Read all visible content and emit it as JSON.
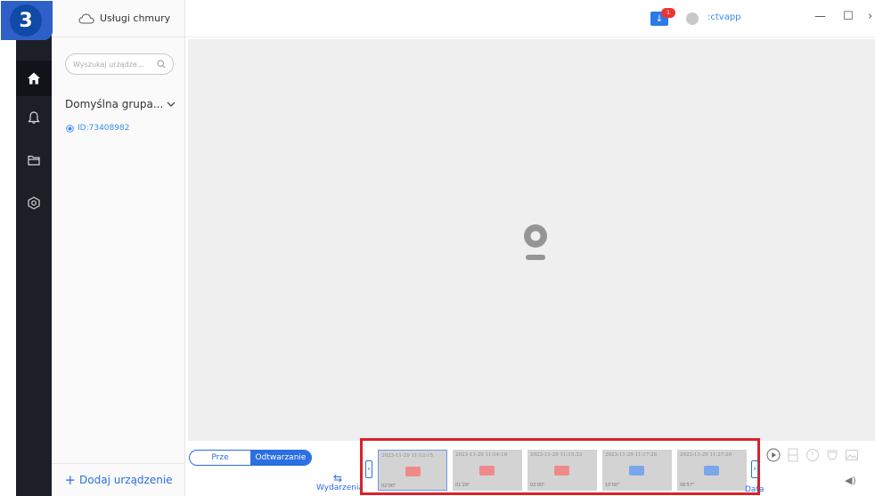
{
  "step_badge": "3",
  "sidebar": {
    "cloud_label": "Usługi chmury",
    "search_placeholder": "Wyszukaj urządze...",
    "group_label": "Domyślna grupa...",
    "device_label": "ID:73408982",
    "add_device_label": "Dodaj urządzenie"
  },
  "rail": {
    "items": [
      {
        "name": "home-icon",
        "active": true
      },
      {
        "name": "bell-icon",
        "active": false
      },
      {
        "name": "folder-icon",
        "active": false
      },
      {
        "name": "settings-icon",
        "active": false
      }
    ]
  },
  "topbar": {
    "notification_count": "1",
    "username": ":ctvapp",
    "minimize": "—",
    "maximize": "☐",
    "close": "›"
  },
  "playback": {
    "mode_options": [
      "Prze",
      "Odtwarzanie"
    ],
    "active_mode": "Odtwarzanie",
    "events_label": "Wydarzenia",
    "date_label": "Data",
    "colors": {
      "accent": "#2b6fe0",
      "highlight": "#d8232a",
      "motion": "#f08a8a",
      "alarm": "#7aa6ec"
    }
  },
  "recordings": [
    {
      "timestamp": "2023-11-29 11:12:15",
      "duration": "02'00\"",
      "type": "motion"
    },
    {
      "timestamp": "2023-11-29 11:14:10",
      "duration": "01'29\"",
      "type": "motion"
    },
    {
      "timestamp": "2023-11-29 11:15:33",
      "duration": "02'00\"",
      "type": "motion"
    },
    {
      "timestamp": "2023-11-29 11:17:28",
      "duration": "10'00\"",
      "type": "alarm"
    },
    {
      "timestamp": "2023-11-29 11:27:20",
      "duration": "06'57\"",
      "type": "alarm"
    }
  ]
}
